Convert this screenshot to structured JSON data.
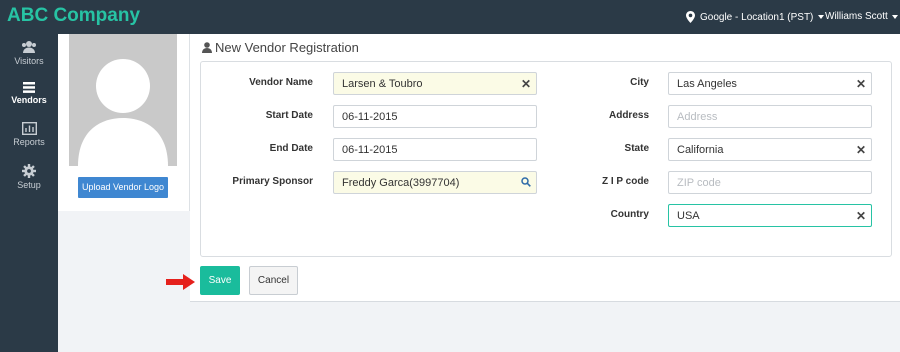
{
  "app": {
    "name": "ABC Company"
  },
  "topbar": {
    "location": "Google - Location1 (PST)",
    "user": "Williams Scott"
  },
  "sidebar": {
    "items": [
      {
        "label": "Visitors",
        "icon": "users-icon"
      },
      {
        "label": "Vendors",
        "icon": "list-icon"
      },
      {
        "label": "Reports",
        "icon": "bar-chart-icon"
      },
      {
        "label": "Setup",
        "icon": "gear-icon"
      }
    ],
    "active": "Vendors"
  },
  "logo_panel": {
    "upload_label": "Upload Vendor Logo"
  },
  "form": {
    "title": "New Vendor Registration",
    "vendor_name": {
      "label": "Vendor Name",
      "value": "Larsen & Toubro"
    },
    "start_date": {
      "label": "Start Date",
      "value": "06-11-2015"
    },
    "end_date": {
      "label": "End Date",
      "value": "06-11-2015"
    },
    "primary_sponsor": {
      "label": "Primary Sponsor",
      "value": "Freddy Garca(3997704)"
    },
    "city": {
      "label": "City",
      "value": "Las Angeles"
    },
    "address": {
      "label": "Address",
      "placeholder": "Address"
    },
    "state": {
      "label": "State",
      "value": "California"
    },
    "zip": {
      "label": "Z I P code",
      "placeholder": "ZIP code"
    },
    "country": {
      "label": "Country",
      "value": "USA"
    }
  },
  "actions": {
    "save_label": "Save",
    "cancel_label": "Cancel"
  },
  "colors": {
    "brand": "#27c3a4",
    "topbar": "#2b3a47",
    "save": "#1abc9c",
    "upload": "#3f87d1",
    "arrow": "#e5201c"
  }
}
